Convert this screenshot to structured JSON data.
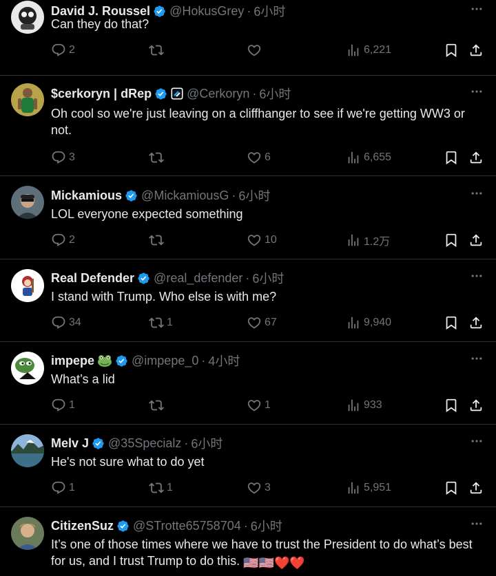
{
  "tweets": [
    {
      "name": "David J. Roussel",
      "handle": "@HokusGrey",
      "time": "6小时",
      "text": "Can they do that?",
      "replies": "2",
      "retweets": "",
      "likes": "",
      "views": "6,221"
    },
    {
      "name": "$cerkoryn | dRep",
      "handle": "@Cerkoryn",
      "time": "6小时",
      "text": "Oh cool so we're just leaving on a cliffhanger to see if we're getting WW3 or not.",
      "replies": "3",
      "retweets": "",
      "likes": "6",
      "views": "6,655"
    },
    {
      "name": "Mickamious",
      "handle": "@MickamiousG",
      "time": "6小时",
      "text": "LOL everyone expected something",
      "replies": "2",
      "retweets": "",
      "likes": "10",
      "views": "1.2万"
    },
    {
      "name": "Real Defender",
      "handle": "@real_defender",
      "time": "6小时",
      "text": "I stand with Trump. Who else is with me?",
      "replies": "34",
      "retweets": "1",
      "likes": "67",
      "views": "9,940"
    },
    {
      "name": "impepe",
      "handle": "@impepe_0",
      "time": "4小时",
      "text": "What’s a lid",
      "replies": "1",
      "retweets": "",
      "likes": "1",
      "views": "933"
    },
    {
      "name": "Melv J",
      "handle": "@35Specialz",
      "time": "6小时",
      "text": "He's not sure what to do yet",
      "replies": "1",
      "retweets": "1",
      "likes": "3",
      "views": "5,951"
    },
    {
      "name": "CitizenSuz",
      "handle": "@STrotte65758704",
      "time": "6小时",
      "text": "It’s one of those times where we have to trust the President to do what’s best for us, and I trust Trump to do this.",
      "text_emoji": "🇺🇸🇺🇸❤️❤️"
    }
  ],
  "colors": {
    "verified": "#1d9bf0",
    "muted": "#71767b",
    "text": "#e7e9ea",
    "divider": "#2f3336",
    "background": "#000000"
  },
  "icons": [
    "reply-icon",
    "retweet-icon",
    "like-icon",
    "views-icon",
    "bookmark-icon",
    "share-icon",
    "more-icon",
    "verified-badge-icon"
  ]
}
